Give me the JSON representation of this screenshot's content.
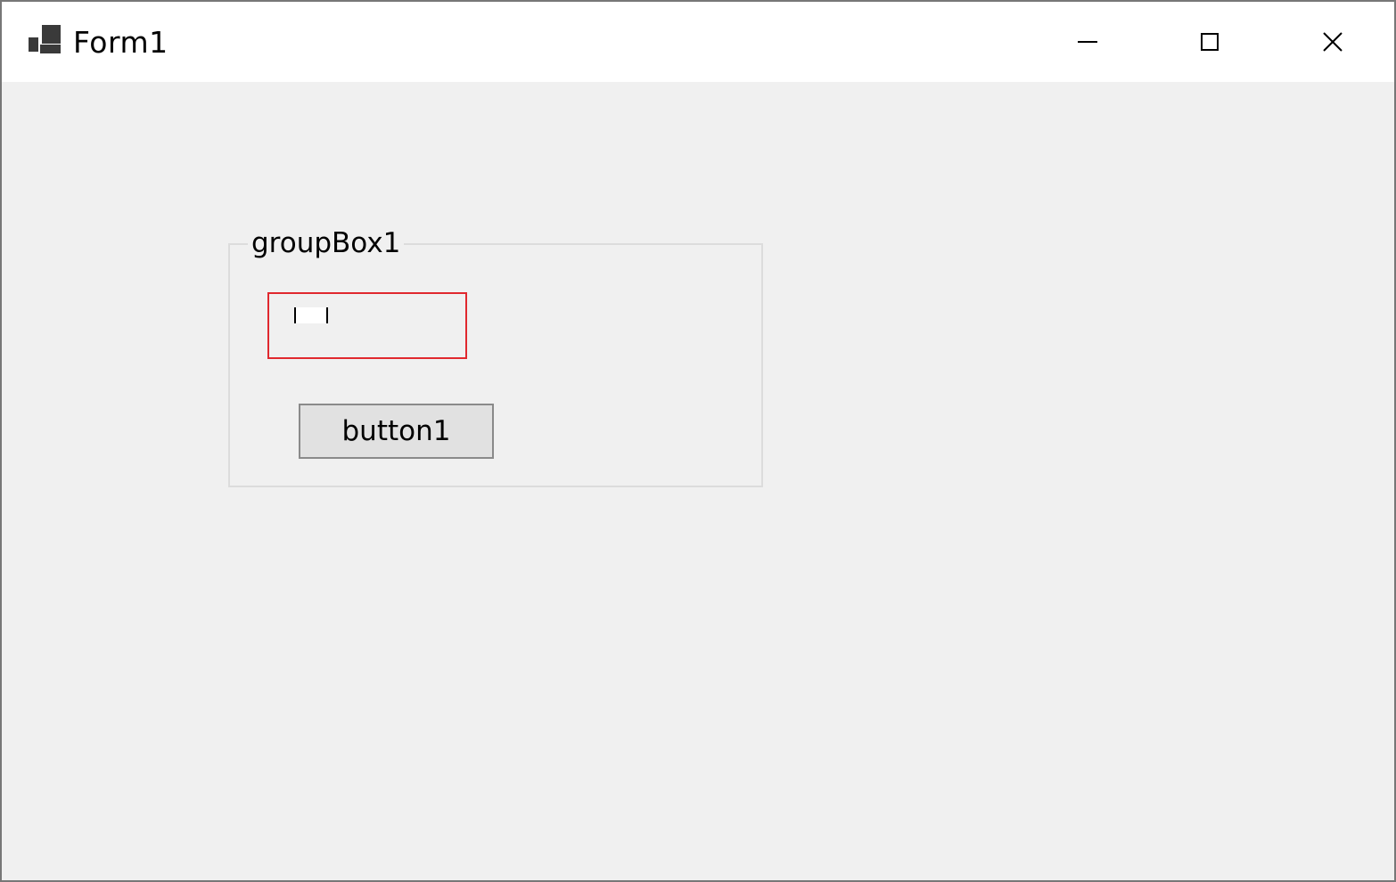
{
  "window": {
    "title": "Form1",
    "app_icon": "windows-forms-app-icon",
    "controls": {
      "minimize_icon": "minimize-icon",
      "maximize_icon": "maximize-icon",
      "close_icon": "close-icon"
    }
  },
  "groupbox": {
    "label": "groupBox1",
    "textbox": {
      "value": "",
      "border_color": "#e0282e"
    },
    "button": {
      "label": "button1"
    }
  },
  "colors": {
    "client_background": "#f0f0f0",
    "titlebar_background": "#ffffff",
    "textbox_error_border": "#e0282e"
  }
}
